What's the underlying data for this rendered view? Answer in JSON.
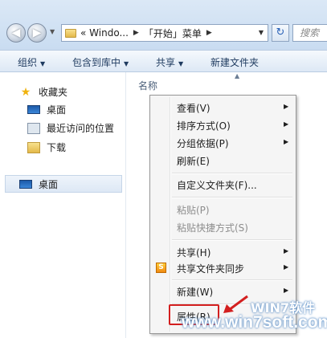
{
  "address": {
    "segments": [
      "« Windo...",
      "「开始」菜单"
    ],
    "search_placeholder": "搜索"
  },
  "toolbar": {
    "organize": "组织",
    "include_library": "包含到库中",
    "share": "共享",
    "new_folder": "新建文件夹"
  },
  "nav": {
    "favorites": "收藏夹",
    "desktop": "桌面",
    "recent": "最近访问的位置",
    "downloads": "下载",
    "desktop_root": "桌面"
  },
  "content": {
    "column_name": "名称"
  },
  "context_menu": {
    "view": "查看(V)",
    "sort_by": "排序方式(O)",
    "group_by": "分组依据(P)",
    "refresh": "刷新(E)",
    "customize_folder": "自定义文件夹(F)...",
    "paste": "粘贴(P)",
    "paste_shortcut": "粘贴快捷方式(S)",
    "share_with": "共享(H)",
    "shared_folder_sync": "共享文件夹同步",
    "new": "新建(W)",
    "properties": "属性(R)"
  },
  "watermark": {
    "title": "WIN7软件",
    "url": "www.win7soft.com"
  },
  "colors": {
    "highlight_red": "#d31f1f",
    "title_bar": "#c9dcf1"
  }
}
